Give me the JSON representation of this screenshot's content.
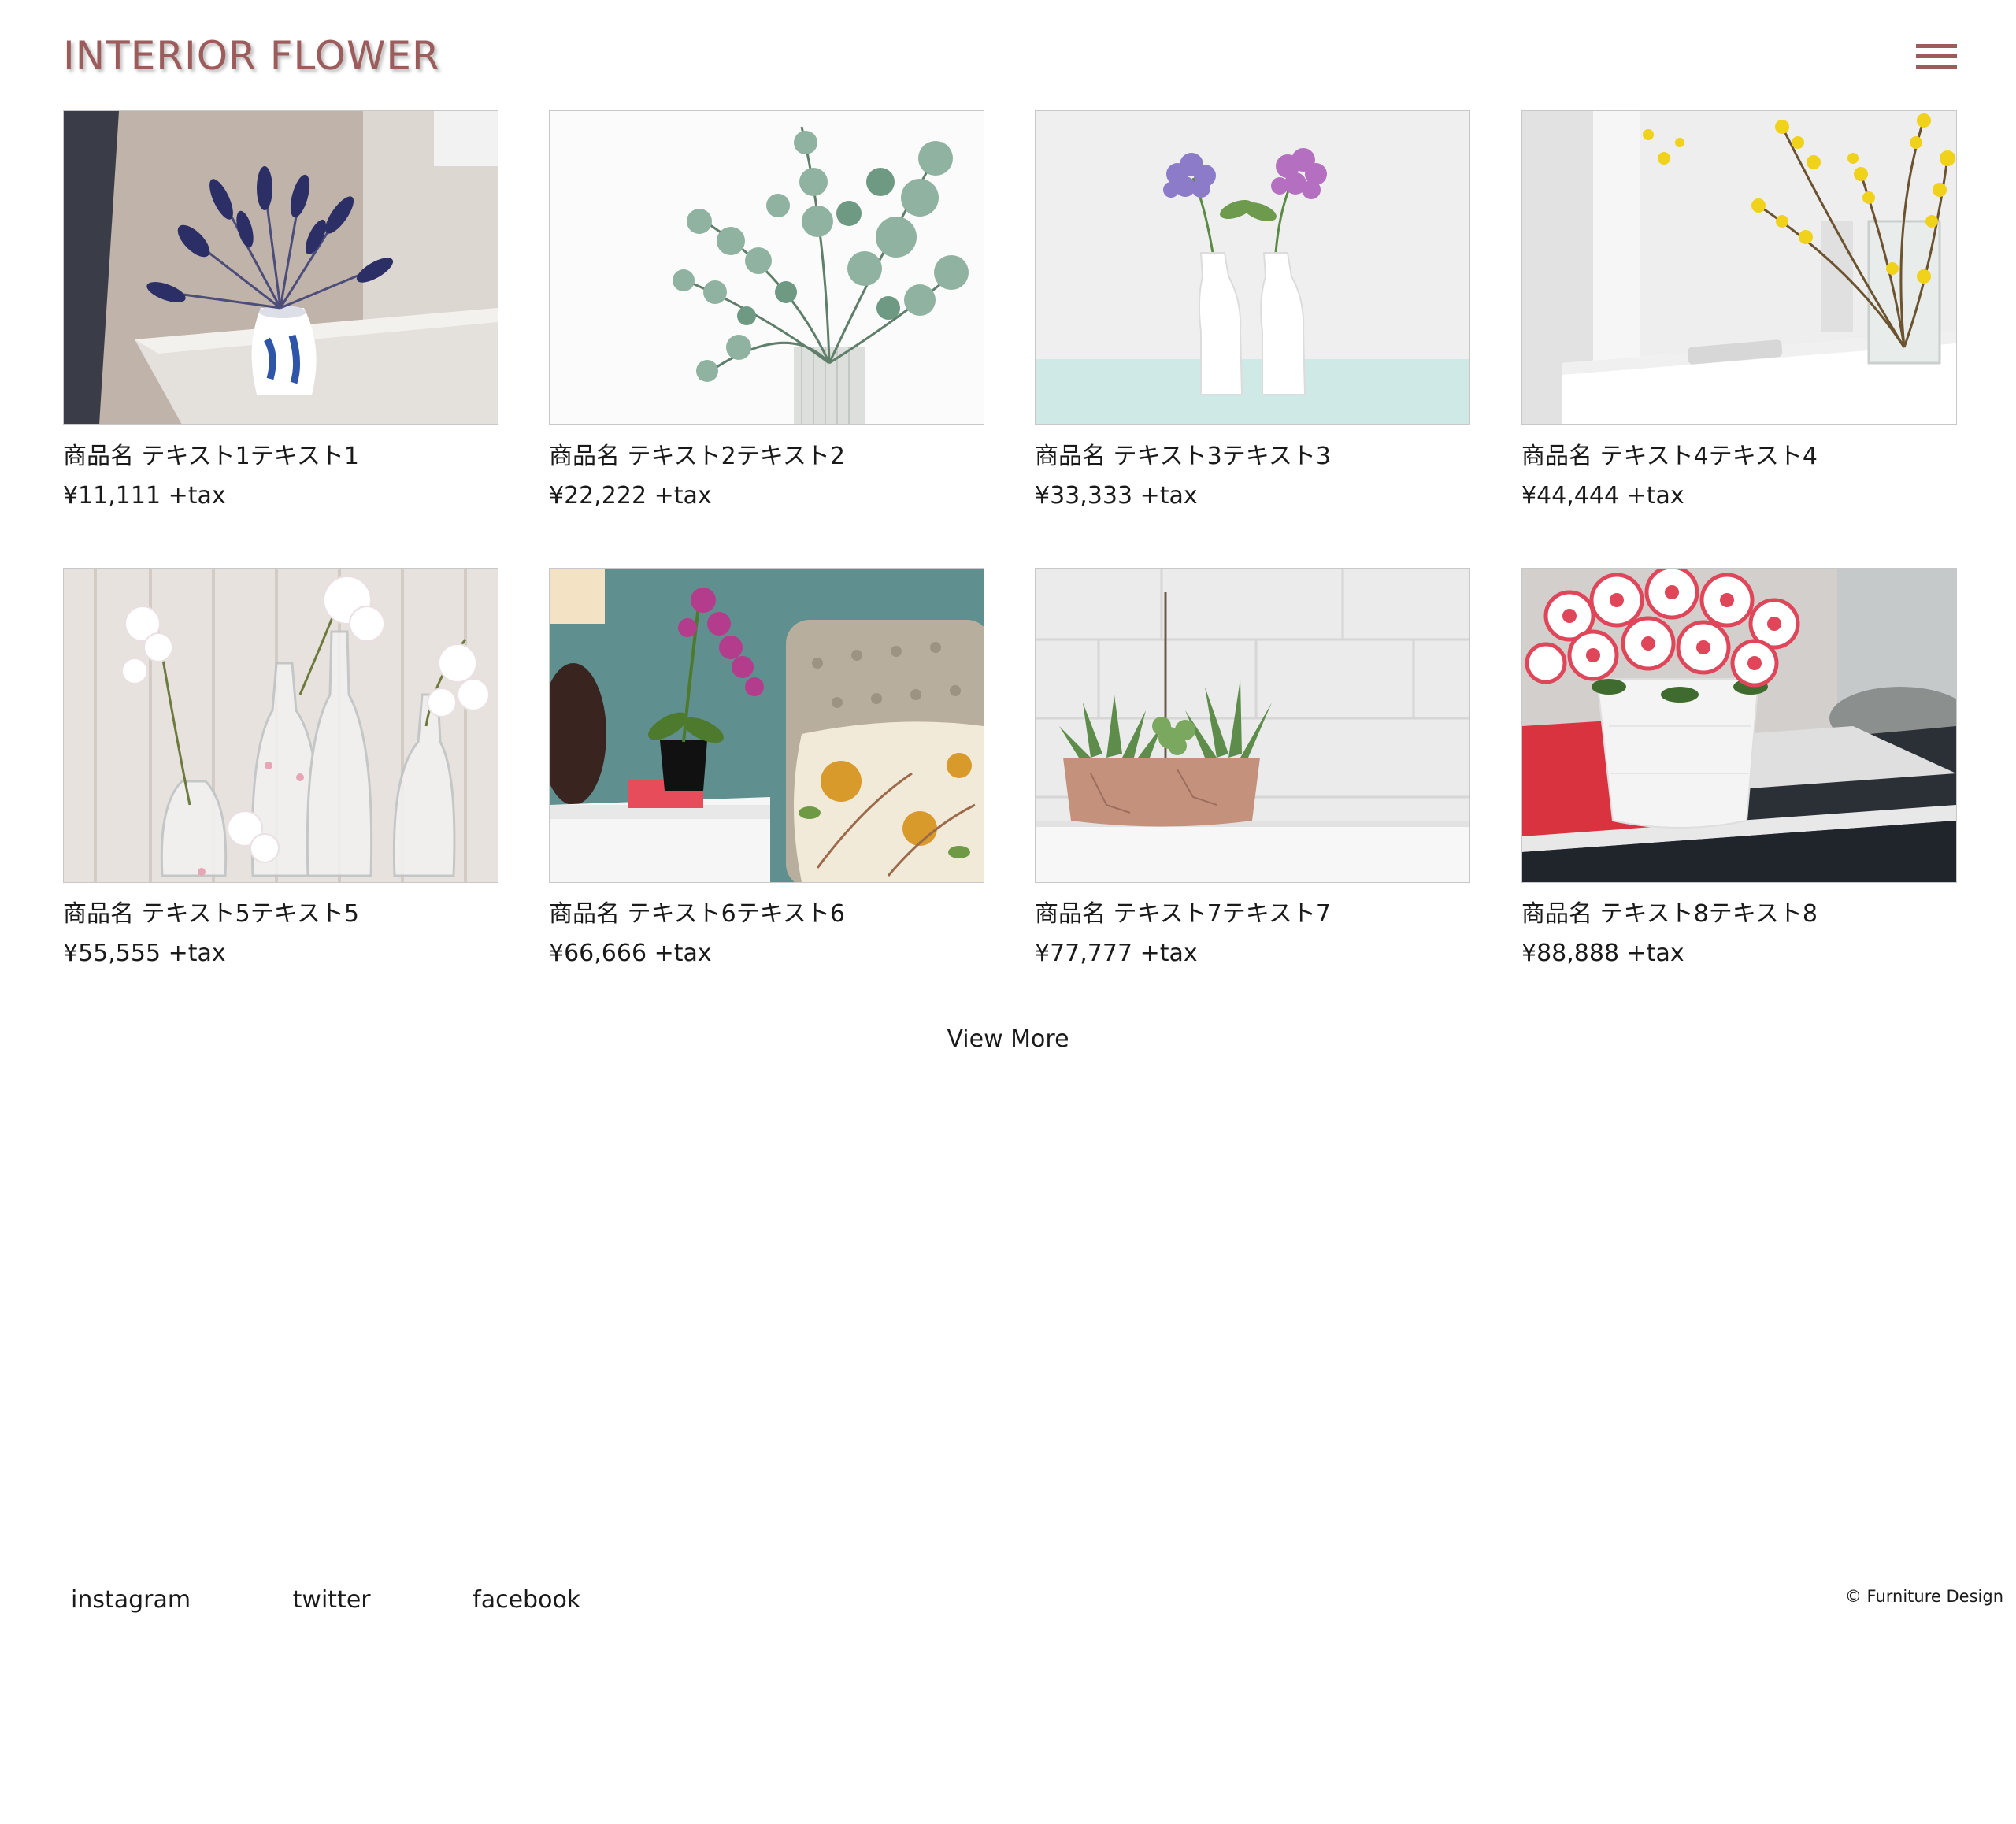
{
  "header": {
    "logo_text": "INTERIOR FLOWER",
    "menu_icon": "hamburger-menu-icon"
  },
  "theme": {
    "accent": "#9d5c5c",
    "text": "#1a1a1a",
    "background": "#ffffff"
  },
  "products": [
    {
      "name": "商品名 テキスト1テキスト1",
      "price": "¥11,111 +tax",
      "image": "lavender in blue pitcher"
    },
    {
      "name": "商品名 テキスト2テキスト2",
      "price": "¥22,222 +tax",
      "image": "eucalyptus in glass vase"
    },
    {
      "name": "商品名 テキスト3テキスト3",
      "price": "¥33,333 +tax",
      "image": "hydrangeas in white bottles"
    },
    {
      "name": "商品名 テキスト4テキスト4",
      "price": "¥44,444 +tax",
      "image": "yellow forsythia in glass vase"
    },
    {
      "name": "商品名 テキスト5テキスト5",
      "price": "¥55,555 +tax",
      "image": "white blossoms in glass bottles"
    },
    {
      "name": "商品名 テキスト6テキスト6",
      "price": "¥66,666 +tax",
      "image": "orchid on bedside table"
    },
    {
      "name": "商品名 テキスト7テキスト7",
      "price": "¥77,777 +tax",
      "image": "succulents in clay pot"
    },
    {
      "name": "商品名 テキスト8テキスト8",
      "price": "¥88,888 +tax",
      "image": "red azalea in white pot"
    }
  ],
  "view_more": "View More",
  "footer": {
    "links": [
      "instagram",
      "twitter",
      "facebook"
    ],
    "copyright": "© Furniture Design"
  }
}
